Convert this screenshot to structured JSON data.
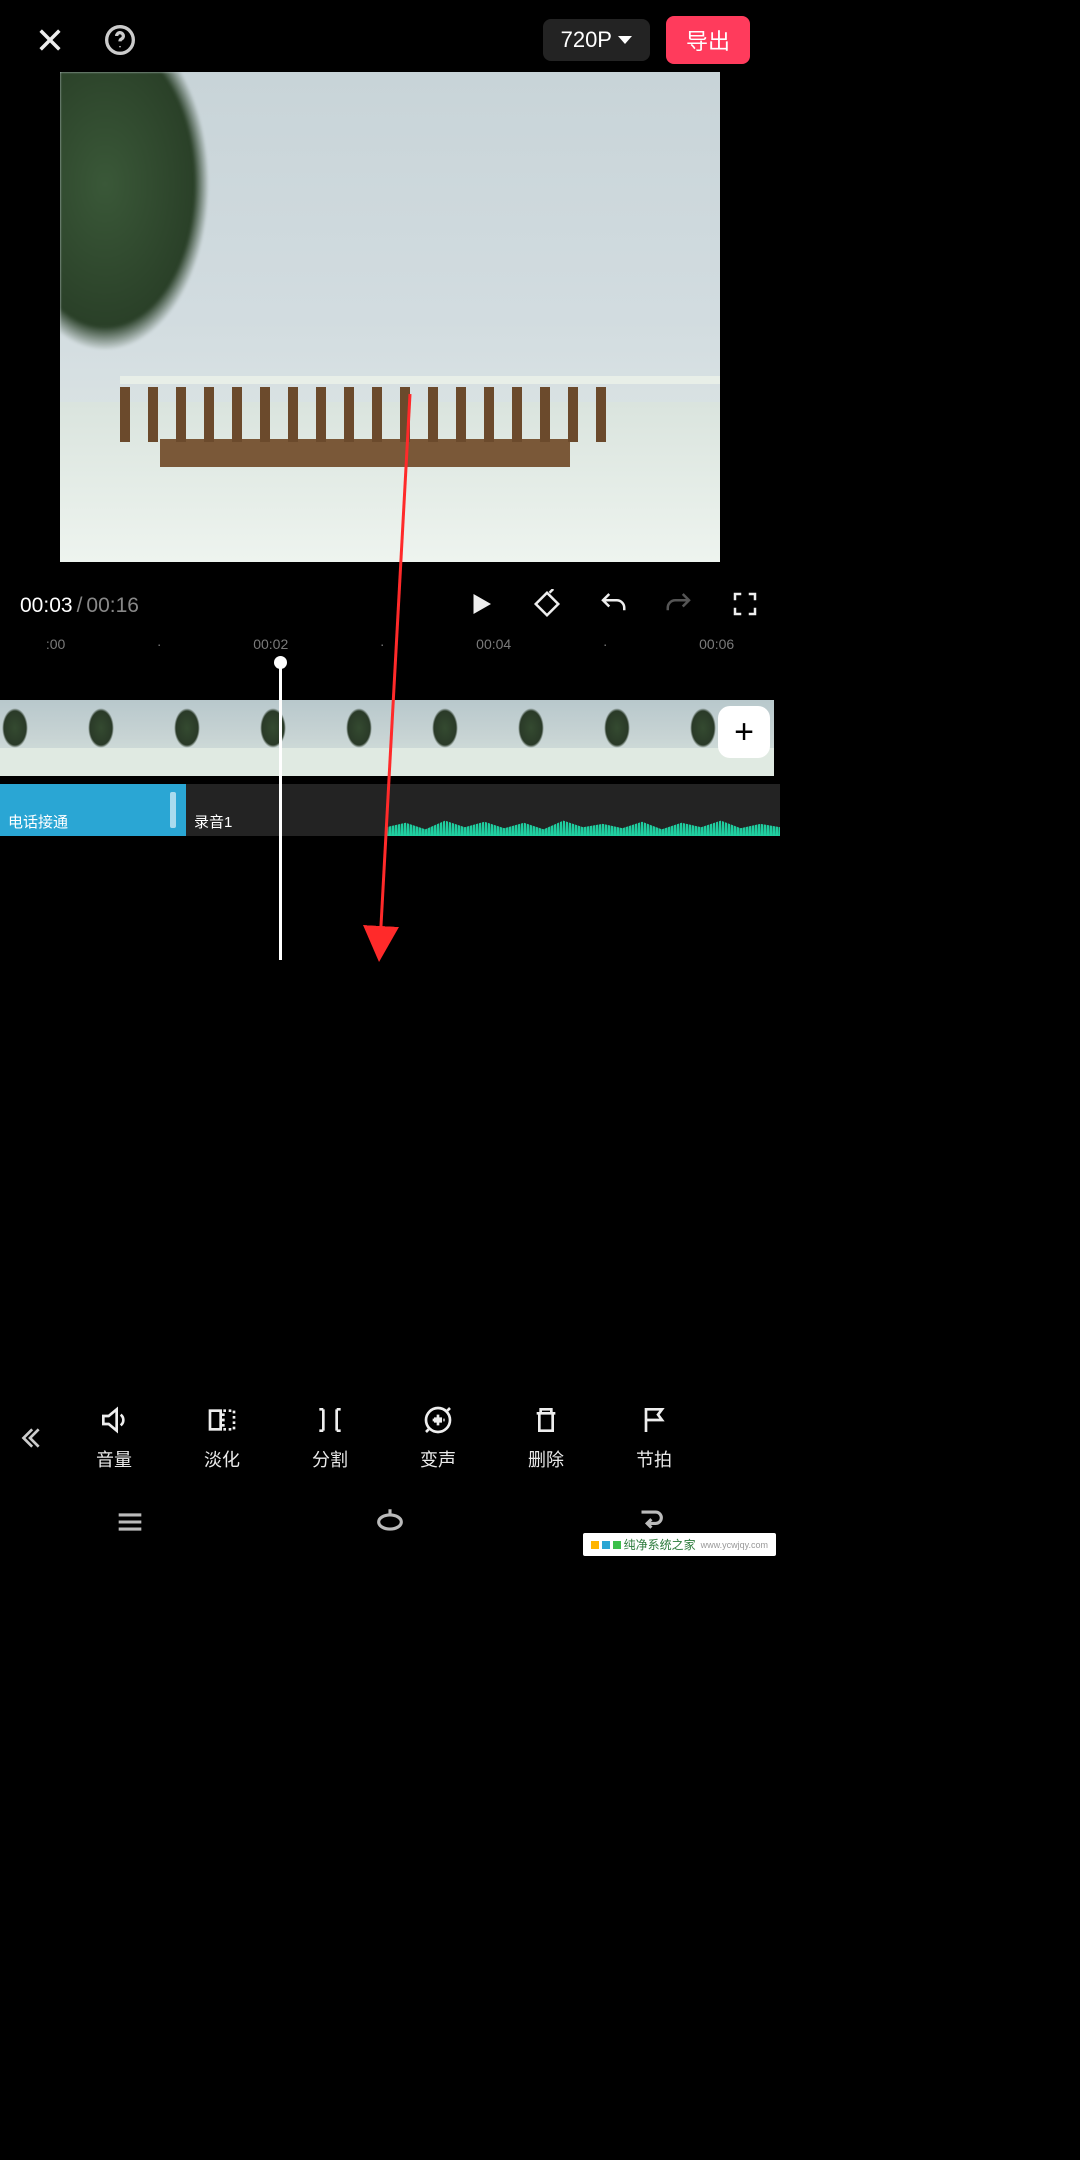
{
  "topbar": {
    "resolution_label": "720P",
    "export_label": "导出"
  },
  "playback": {
    "current_time": "00:03",
    "separator": "/",
    "total_time": "00:16"
  },
  "ruler": {
    "marks": [
      ":00",
      "00:02",
      "00:04",
      "00:06"
    ]
  },
  "audio": {
    "track1_label": "电话接通",
    "track2_label": "录音1"
  },
  "add_clip_label": "+",
  "toolbar": {
    "items": [
      {
        "id": "volume",
        "label": "音量"
      },
      {
        "id": "fade",
        "label": "淡化"
      },
      {
        "id": "split",
        "label": "分割"
      },
      {
        "id": "voice",
        "label": "变声"
      },
      {
        "id": "delete",
        "label": "删除"
      },
      {
        "id": "beat",
        "label": "节拍"
      }
    ]
  },
  "watermark": {
    "text": "纯净系统之家",
    "sub": "www.ycwjqy.com"
  },
  "colors": {
    "accent": "#ff3b5c",
    "track_blue": "#2aa6d4",
    "wave_teal": "#1fcfa0"
  }
}
